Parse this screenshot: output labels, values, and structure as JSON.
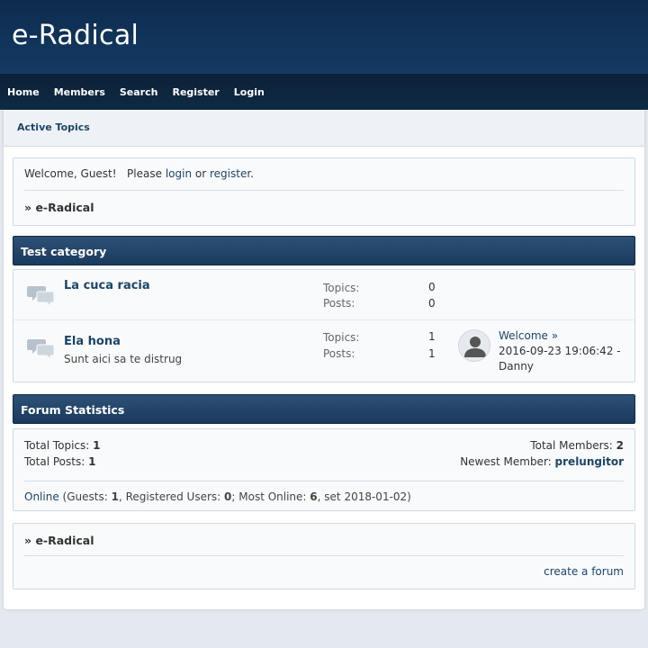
{
  "site": {
    "title": "e-Radical"
  },
  "nav": [
    "Home",
    "Members",
    "Search",
    "Register",
    "Login"
  ],
  "subnav": {
    "active_topics": "Active Topics"
  },
  "welcome": {
    "greeting": "Welcome, Guest!",
    "please": "Please",
    "login": "login",
    "or": "or",
    "register": "register",
    "period": ".",
    "breadcrumb_prefix": "»",
    "breadcrumb": "e-Radical"
  },
  "category": {
    "name": "Test category",
    "boards": [
      {
        "name": "La cuca racia",
        "description": "",
        "topics_label": "Topics:",
        "topics": "0",
        "posts_label": "Posts:",
        "posts": "0"
      },
      {
        "name": "Ela hona",
        "description": "Sunt aici sa te distrug",
        "topics_label": "Topics:",
        "topics": "1",
        "posts_label": "Posts:",
        "posts": "1",
        "last_post": {
          "title": "Welcome",
          "arrow": "»",
          "date": "2016-09-23 19:06:42 -",
          "author": "Danny"
        }
      }
    ]
  },
  "stats": {
    "header": "Forum Statistics",
    "total_topics_label": "Total Topics:",
    "total_topics": "1",
    "total_posts_label": "Total Posts:",
    "total_posts": "1",
    "total_members_label": "Total Members:",
    "total_members": "2",
    "newest_member_label": "Newest Member:",
    "newest_member": "prelungitor",
    "online_link": "Online",
    "guests_label": "(Guests:",
    "guests": "1",
    "registered_label": ", Registered Users:",
    "registered": "0",
    "most_online_label": "; Most Online:",
    "most_online": "6",
    "most_online_date": ", set 2018-01-02)"
  },
  "footer": {
    "breadcrumb_prefix": "»",
    "breadcrumb": "e-Radical",
    "create_forum": "create a forum"
  }
}
